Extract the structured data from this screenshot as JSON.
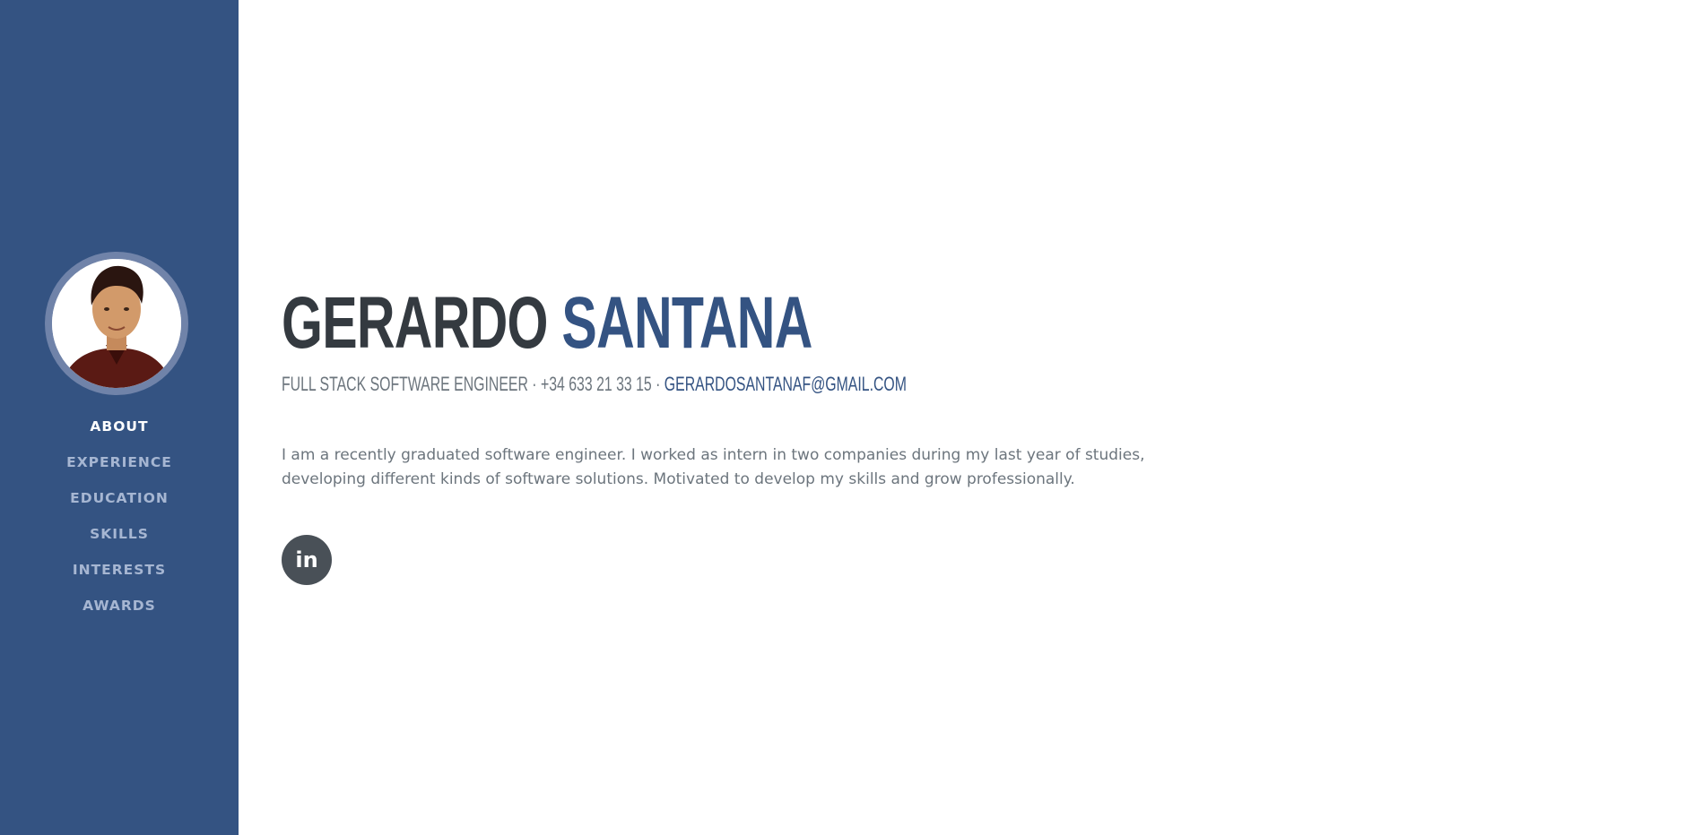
{
  "nav": {
    "items": [
      {
        "label": "ABOUT",
        "active": true
      },
      {
        "label": "EXPERIENCE",
        "active": false
      },
      {
        "label": "EDUCATION",
        "active": false
      },
      {
        "label": "SKILLS",
        "active": false
      },
      {
        "label": "INTERESTS",
        "active": false
      },
      {
        "label": "AWARDS",
        "active": false
      }
    ]
  },
  "profile": {
    "first_name": "GERARDO",
    "last_name": "SANTANA",
    "subheading_text": "FULL STACK SOFTWARE ENGINEER · +34 633 21 33 15 · ",
    "email": "GERARDOSANTANAF@GMAIL.COM",
    "lead": "I am a recently graduated software engineer. I worked as intern in two companies during my last year of studies, developing different kinds of software solutions. Motivated to develop my skills and grow professionally."
  },
  "social": {
    "linkedin_glyph": "in",
    "icon": "linkedin-icon"
  },
  "colors": {
    "primary": "#345382",
    "heading": "#343a40",
    "muted": "#6c757d"
  }
}
